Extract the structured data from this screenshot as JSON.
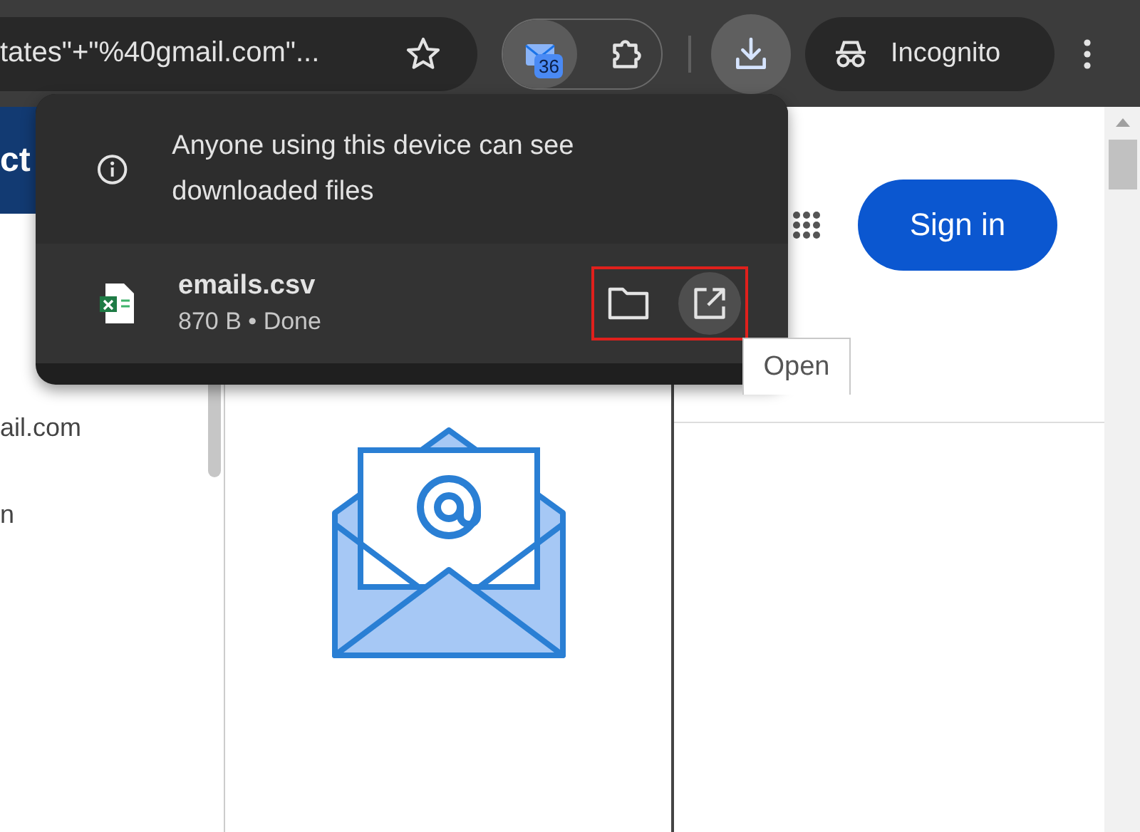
{
  "toolbar": {
    "address": "tates\"+\"%40gmail.com\"...",
    "extension_badge": "36",
    "profile": "Incognito"
  },
  "downloads_popup": {
    "notice": "Anyone using this device can see downloaded files",
    "items": [
      {
        "name": "emails.csv",
        "status": "870 B • Done",
        "highlighted": true
      }
    ]
  },
  "tooltip": "Open",
  "page": {
    "header_text": "ct",
    "sidebar_lines": [
      "ail.com",
      "n"
    ],
    "sign_in": "Sign in"
  }
}
